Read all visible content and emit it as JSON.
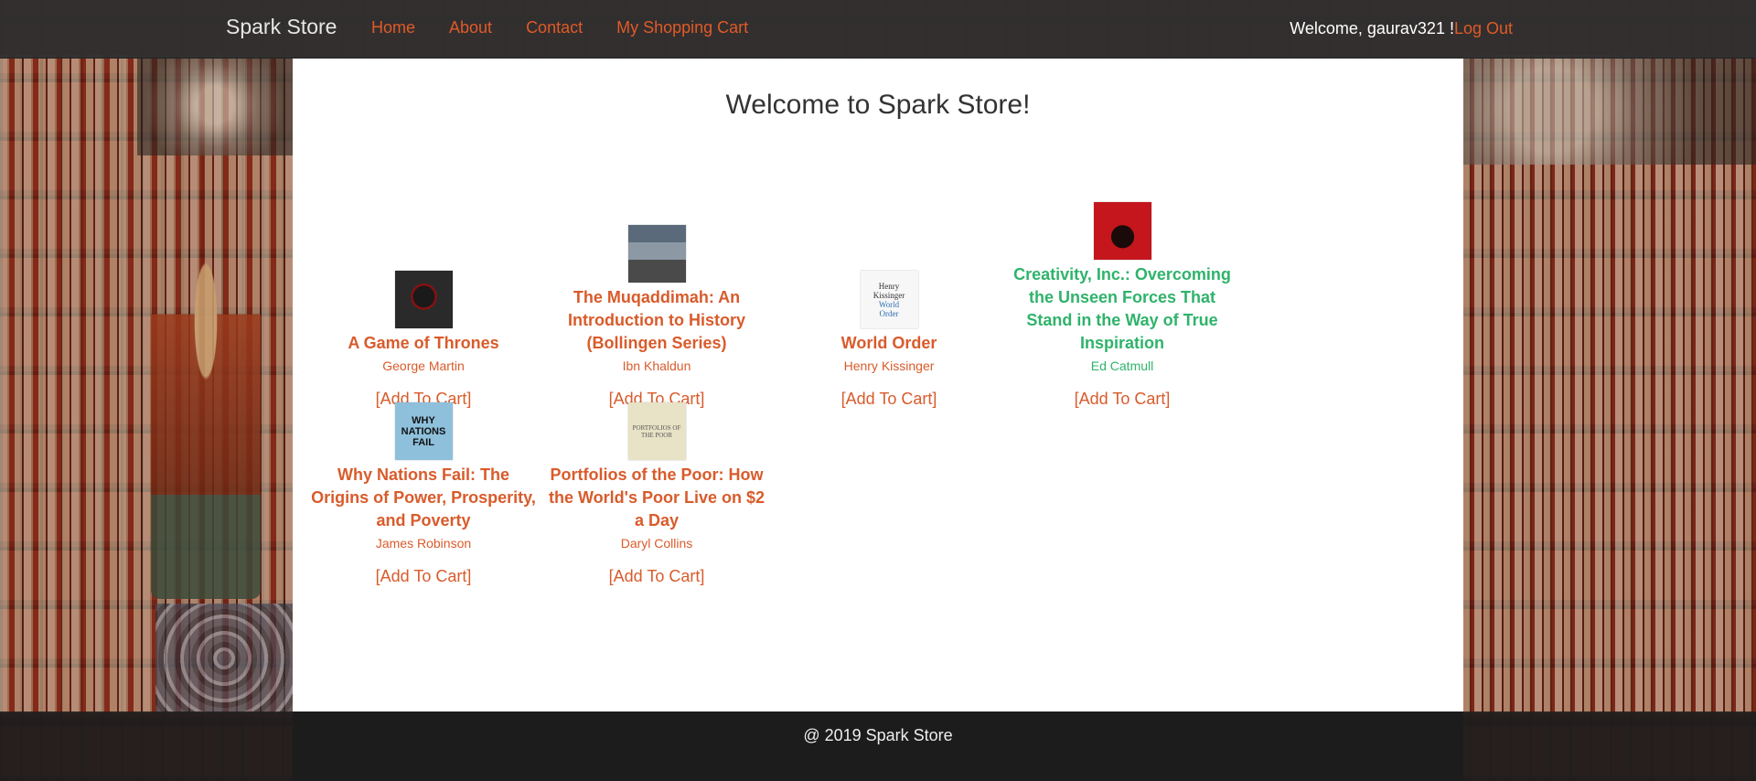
{
  "navbar": {
    "brand": "Spark Store",
    "links": [
      "Home",
      "About",
      "Contact",
      "My Shopping Cart"
    ],
    "welcome": "Welcome, gaurav321 !",
    "logout": "Log Out"
  },
  "main": {
    "title": "Welcome to Spark Store!",
    "add_to_cart_label": "[Add To Cart]",
    "products": [
      {
        "title": "A Game of Thrones",
        "author": "George Martin",
        "cover_icon": "book-cover-dark",
        "highlight": false
      },
      {
        "title": "The Muqaddimah: An Introduction to History (Bollingen Series)",
        "author": "Ibn Khaldun",
        "cover_icon": "book-cover-architecture",
        "highlight": false
      },
      {
        "title": "World Order",
        "author": "Henry Kissinger",
        "cover_icon": "book-cover-white",
        "highlight": false
      },
      {
        "title": "Creativity, Inc.: Overcoming the Unseen Forces That Stand in the Way of True Inspiration",
        "author": "Ed Catmull",
        "cover_icon": "book-cover-red",
        "highlight": true
      },
      {
        "title": "Why Nations Fail: The Origins of Power, Prosperity, and Poverty",
        "author": "James Robinson",
        "cover_icon": "book-cover-blue",
        "highlight": false
      },
      {
        "title": "Portfolios of the Poor: How the World's Poor Live on $2 a Day",
        "author": "Daryl Collins",
        "cover_icon": "book-cover-beige",
        "highlight": false
      }
    ],
    "cover_text": {
      "world_order": [
        "Henry",
        "Kissinger",
        "World",
        "Order"
      ],
      "why_nations_fail": [
        "WHY",
        "NATIONS",
        "FAIL"
      ],
      "portfolios": "PORTFOLIOS OF THE POOR"
    }
  },
  "footer": {
    "text": "@ 2019 Spark Store"
  },
  "colors": {
    "link": "#e05a28",
    "hover_highlight": "#2fb36b",
    "navbar_bg": "#303030",
    "footer_bg": "#1c1c1c"
  }
}
